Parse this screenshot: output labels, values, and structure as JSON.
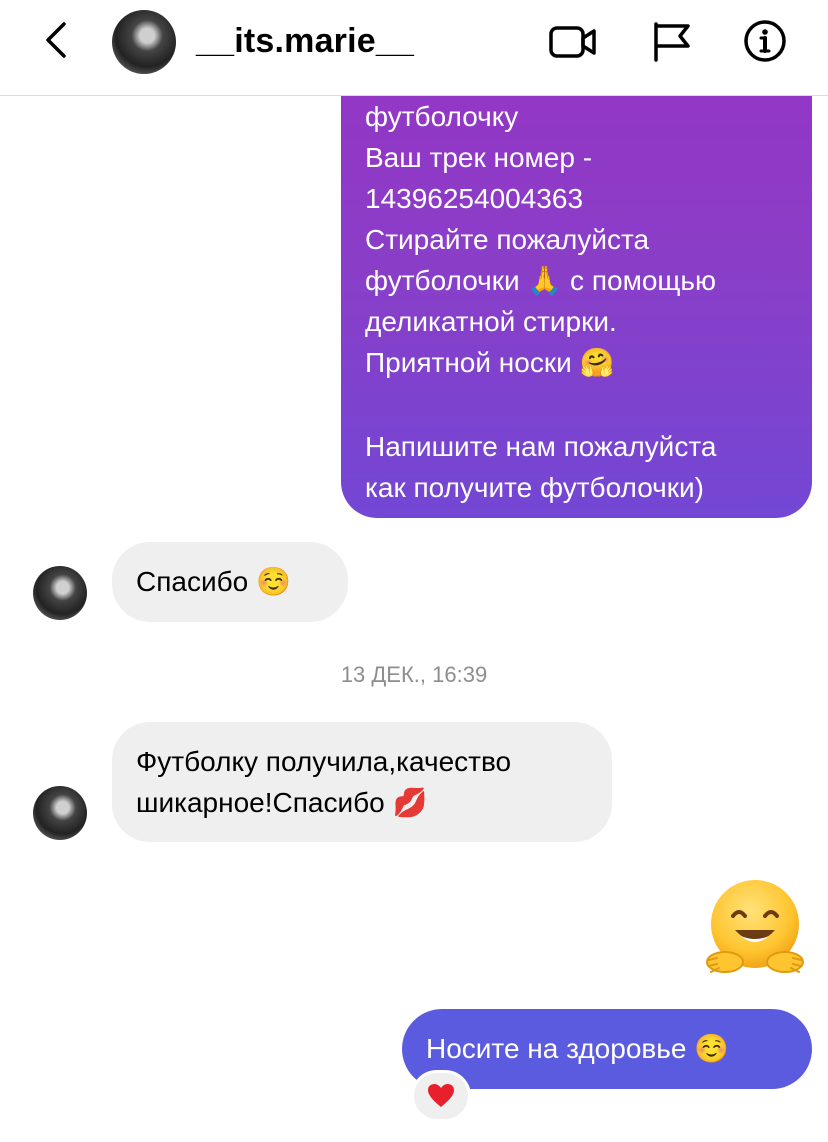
{
  "header": {
    "username": "__its.marie__",
    "icons": [
      "back-arrow-icon",
      "video-call-icon",
      "flag-icon",
      "info-icon"
    ]
  },
  "messages": {
    "outgoing_1": {
      "lines": [
        "футболочку",
        "Ваш трек номер -",
        "14396254004363",
        "Стирайте пожалуйста",
        "футболочки 🙏 с помощью",
        "деликатной стирки.",
        "Приятной носки 🤗",
        "Напишите нам пожалуйста",
        "как получите футболочки)"
      ]
    },
    "incoming_1": {
      "text": "Спасибо ☺️"
    },
    "timestamp": "13 ДЕК., 16:39",
    "incoming_2": {
      "line1": "Футболку получила,качество",
      "line2": "шикарное!Спасибо 💋"
    },
    "outgoing_emoji": "🤗",
    "outgoing_2": {
      "text": "Носите на здоровье ☺️"
    },
    "reaction": "❤️"
  },
  "colors": {
    "gradient_top": "#9435c5",
    "gradient_bottom": "#7347d4",
    "outgoing_blue": "#5b5bdf",
    "incoming_bg": "#efefef"
  }
}
